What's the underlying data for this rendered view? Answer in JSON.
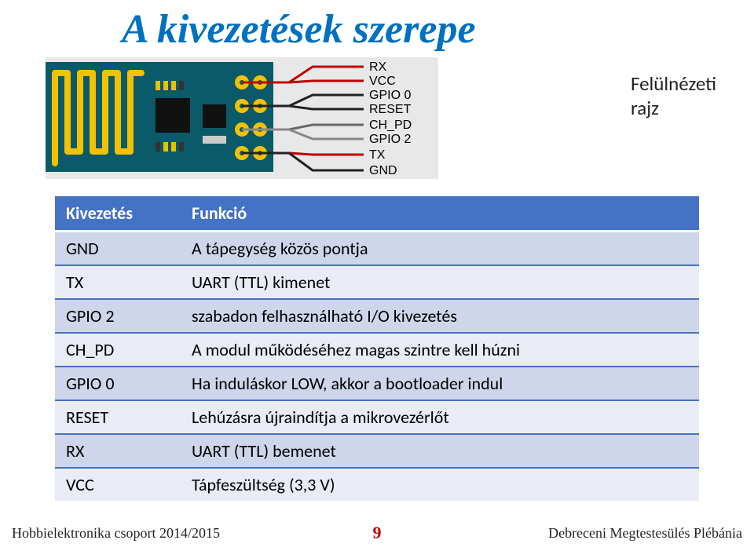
{
  "title": "A kivezetések szerepe",
  "caption": "Felülnézeti rajz",
  "pinLabels": [
    "RX",
    "VCC",
    "GPIO 0",
    "RESET",
    "CH_PD",
    "GPIO 2",
    "TX",
    "GND"
  ],
  "pinColors": [
    "#c00000",
    "#c00000",
    "#222",
    "#222",
    "#666",
    "#888",
    "#c00000",
    "#222"
  ],
  "table": {
    "headers": [
      "Kivezetés",
      "Funkció"
    ],
    "rows": [
      [
        "GND",
        "A tápegység közös pontja"
      ],
      [
        "TX",
        "UART (TTL) kimenet"
      ],
      [
        "GPIO 2",
        "szabadon felhasználható I/O kivezetés"
      ],
      [
        "CH_PD",
        "A modul működéséhez magas szintre  kell húzni"
      ],
      [
        "GPIO 0",
        "Ha induláskor LOW, akkor a bootloader indul"
      ],
      [
        "RESET",
        "Lehúzásra újraindítja a mikrovezérlőt"
      ],
      [
        "RX",
        "UART (TTL) bemenet"
      ],
      [
        "VCC",
        "Tápfeszültség (3,3 V)"
      ]
    ]
  },
  "footer": {
    "left": "Hobbielektronika csoport 2014/2015",
    "page": "9",
    "right": "Debreceni Megtestesülés Plébánia"
  }
}
